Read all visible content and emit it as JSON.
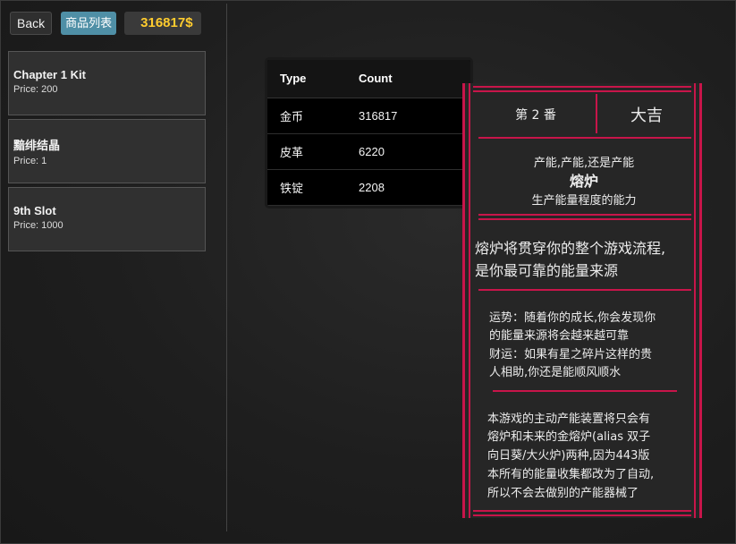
{
  "toolbar": {
    "back_label": "Back",
    "list_label": "商品列表",
    "money": "316817$"
  },
  "shop_items": [
    {
      "name": "Chapter 1 Kit",
      "price": "Price: 200"
    },
    {
      "name": "黯绯结晶",
      "price": "Price: 1"
    },
    {
      "name": "9th Slot",
      "price": "Price: 1000"
    }
  ],
  "inventory": {
    "headers": {
      "type": "Type",
      "count": "Count"
    },
    "rows": [
      {
        "type": "金币",
        "count": "316817"
      },
      {
        "type": "皮革",
        "count": "6220"
      },
      {
        "type": "铁锭",
        "count": "2208"
      }
    ]
  },
  "card": {
    "number": "第 2 番",
    "fortune": "大吉",
    "subtitle": "产能,产能,还是产能",
    "title": "熔炉",
    "desc": "生产能量程度的能力",
    "main_line1": "熔炉将贯穿你的整个游戏流程,",
    "main_line2": "是你最可靠的能量来源",
    "fortune_lines": [
      "运势：随着你的成长,你会发现你",
      "的能量来源将会越来越可靠",
      "财运：如果有星之碎片这样的贵",
      "人相助,你还是能顺风顺水"
    ],
    "note_lines": [
      "本游戏的主动产能装置将只会有",
      "熔炉和未来的金熔炉(alias 双子",
      "向日葵/大火炉)两种,因为443版",
      "本所有的能量收集都改为了自动,",
      "所以不会去做别的产能器械了"
    ]
  }
}
